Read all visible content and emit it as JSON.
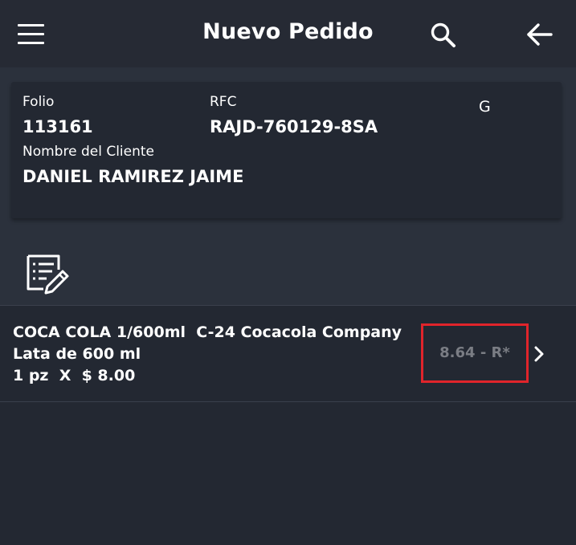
{
  "header": {
    "title": "Nuevo Pedido",
    "menu_icon": "menu-icon",
    "search_icon": "search-icon",
    "back_icon": "arrow-left-icon"
  },
  "client": {
    "folio_label": "Folio",
    "folio": "113161",
    "rfc_label": "RFC",
    "rfc": "RAJD-760129-8SA",
    "type": "G",
    "name_label": "Nombre del Cliente",
    "name": "DANIEL RAMIREZ JAIME"
  },
  "notes_icon": "notes-edit-icon",
  "items": [
    {
      "description": "COCA COLA 1/600ml  C-24 Cocacola Company",
      "presentation": "Lata de 600 ml",
      "quantity_price": "1 pz  X  $ 8.00",
      "total": "8.64 - R*",
      "chevron_icon": "chevron-right-icon"
    }
  ],
  "colors": {
    "appbar": "#262a34",
    "background": "#2b313c",
    "card": "#232832",
    "highlight": "#e0242b",
    "muted_text": "#7a7d84"
  }
}
